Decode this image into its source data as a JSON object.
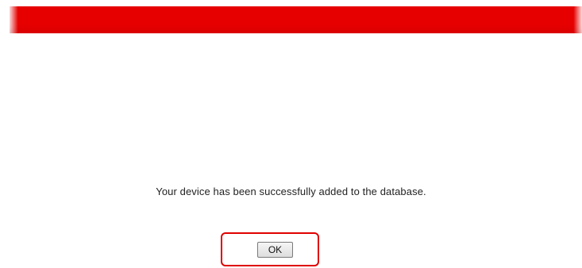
{
  "header": {
    "bar_color": "#e60000"
  },
  "dialog": {
    "message": "Your device has been successfully added to the database.",
    "ok_label": "OK"
  },
  "annotation": {
    "highlight_color": "#e00000"
  }
}
